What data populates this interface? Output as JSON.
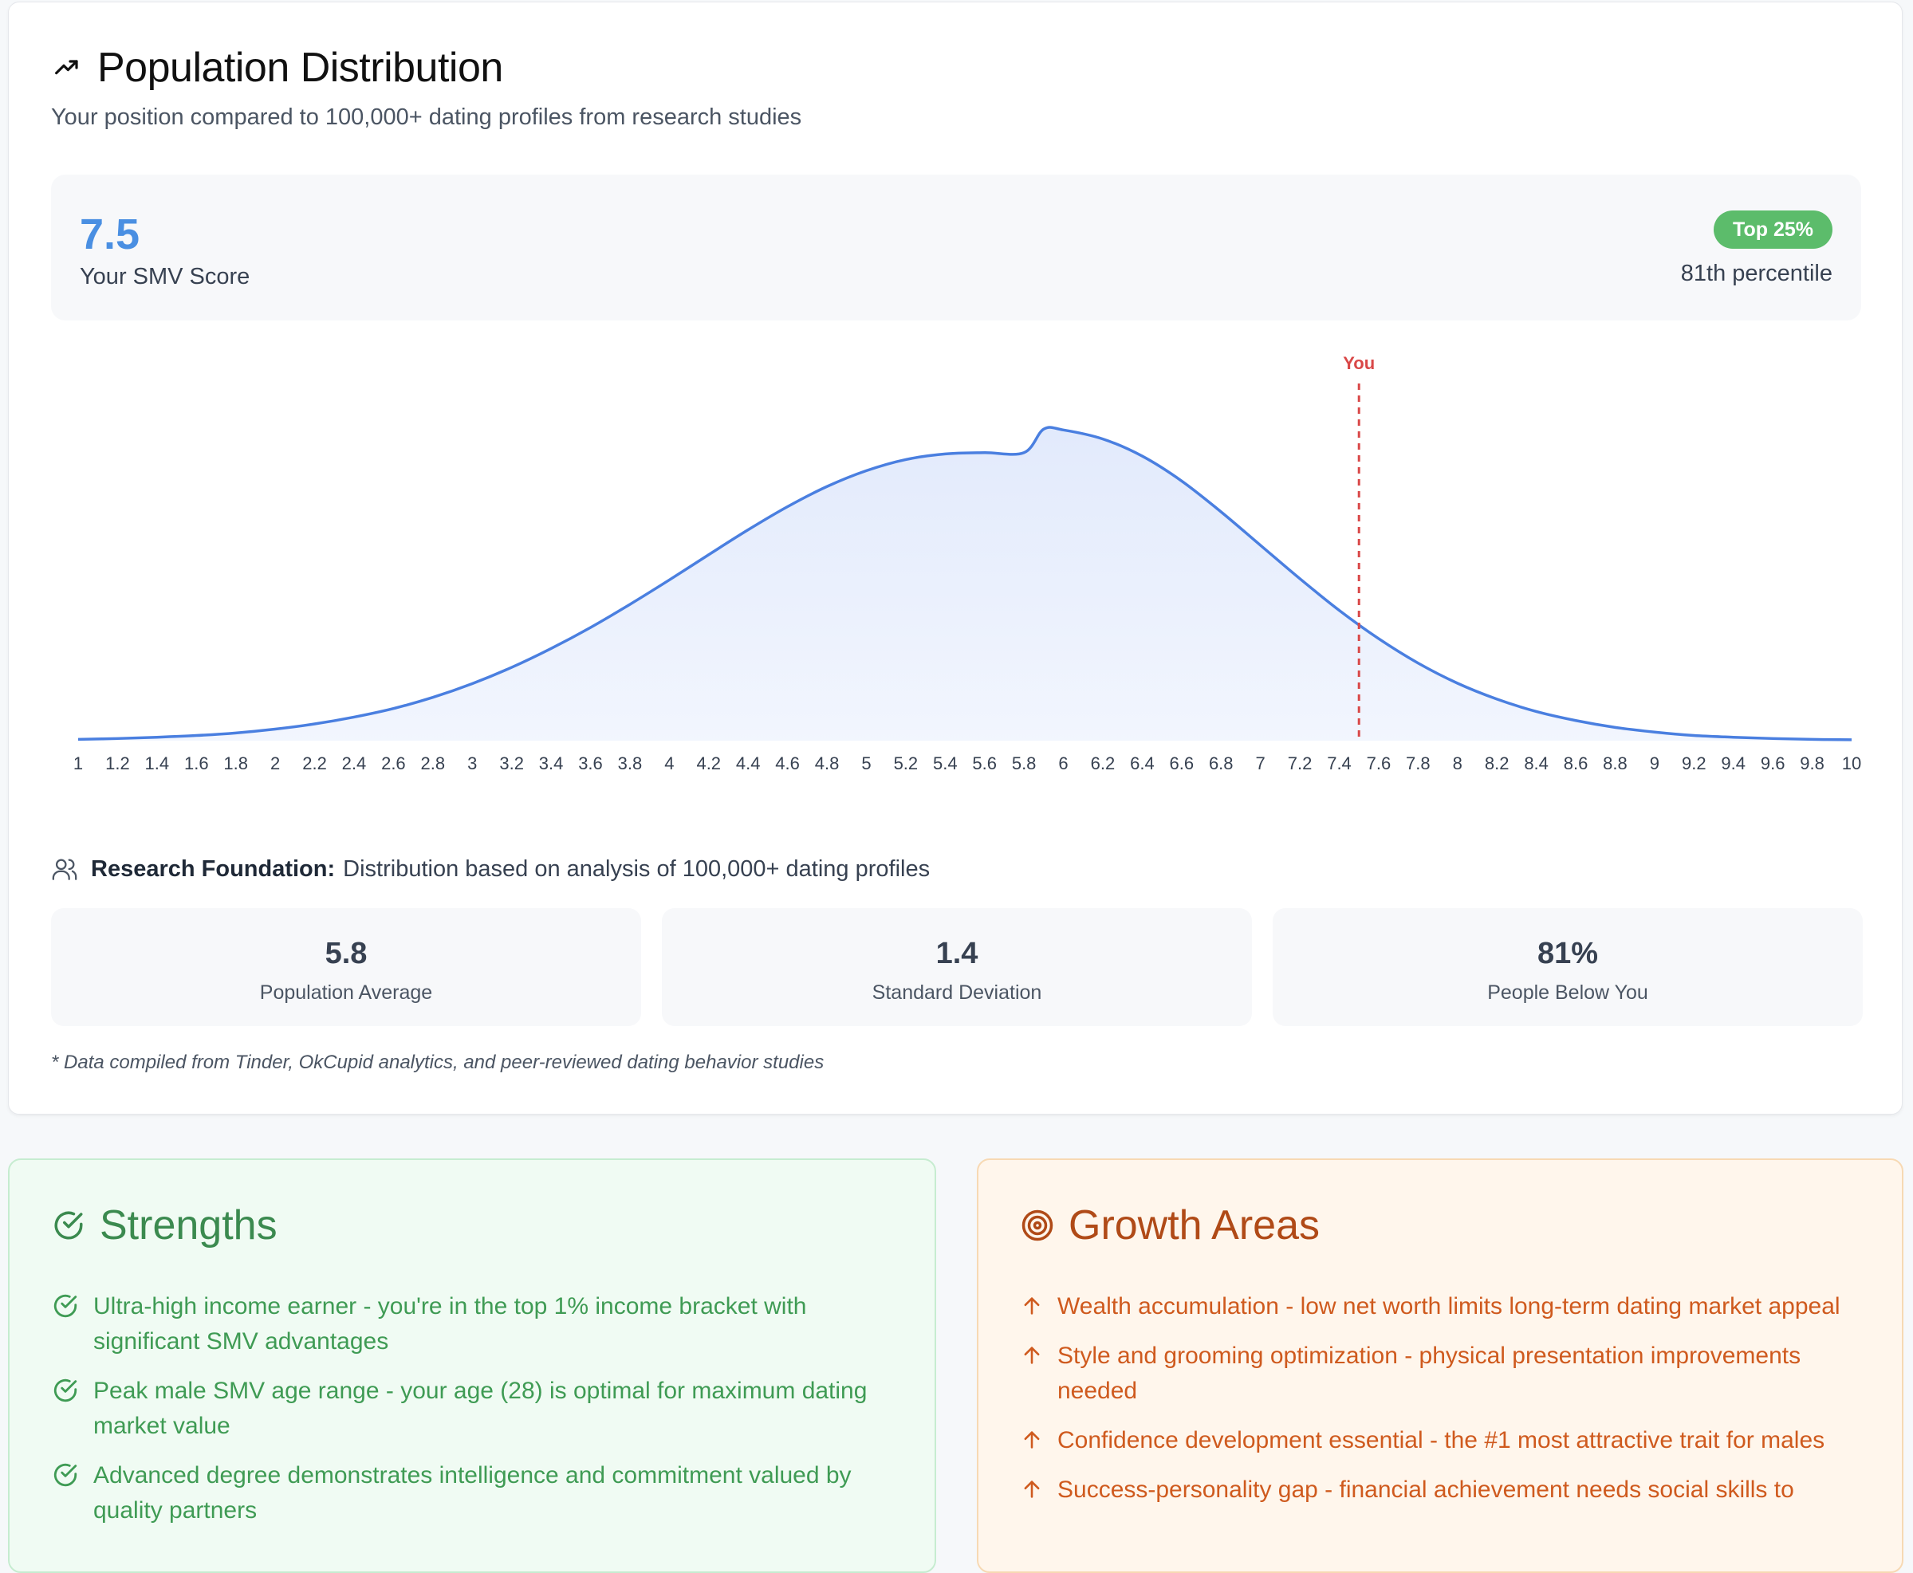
{
  "distribution": {
    "title": "Population Distribution",
    "subtitle": "Your position compared to 100,000+ dating profiles from research studies",
    "score": {
      "value": "7.5",
      "label": "Your SMV Score"
    },
    "badge": "Top 25%",
    "percentile": "81th percentile",
    "research": {
      "bold": "Research Foundation:",
      "text": "Distribution based on analysis of 100,000+ dating profiles"
    },
    "stats": [
      {
        "value": "5.8",
        "label": "Population Average"
      },
      {
        "value": "1.4",
        "label": "Standard Deviation"
      },
      {
        "value": "81%",
        "label": "People Below You"
      }
    ],
    "footnote": "* Data compiled from Tinder, OkCupid analytics, and peer-reviewed dating behavior studies"
  },
  "chart_data": {
    "type": "area",
    "title": "",
    "xlabel": "",
    "ylabel": "",
    "xlim": [
      1,
      10
    ],
    "x_ticks": [
      "1",
      "1.2",
      "1.4",
      "1.6",
      "1.8",
      "2",
      "2.2",
      "2.4",
      "2.6",
      "2.8",
      "3",
      "3.2",
      "3.4",
      "3.6",
      "3.8",
      "4",
      "4.2",
      "4.4",
      "4.6",
      "4.8",
      "5",
      "5.2",
      "5.4",
      "5.6",
      "5.8",
      "6",
      "6.2",
      "6.4",
      "6.6",
      "6.8",
      "7",
      "7.2",
      "7.4",
      "7.6",
      "7.8",
      "8",
      "8.2",
      "8.4",
      "8.6",
      "8.8",
      "9",
      "9.2",
      "9.4",
      "9.6",
      "9.8",
      "10"
    ],
    "series": [
      {
        "x": [
          1,
          1.2,
          1.4,
          1.6,
          1.8,
          2,
          2.2,
          2.4,
          2.6,
          2.8,
          3,
          3.2,
          3.4,
          3.6,
          3.8,
          4,
          4.2,
          4.4,
          4.6,
          4.8,
          5,
          5.2,
          5.4,
          5.6,
          5.8,
          5.9,
          6,
          6.2,
          6.4,
          6.6,
          6.8,
          7,
          7.2,
          7.4,
          7.6,
          7.8,
          8,
          8.2,
          8.4,
          8.6,
          8.8,
          9,
          9.2,
          9.4,
          9.6,
          9.8,
          10
        ],
        "values": [
          0.003,
          0.005,
          0.008,
          0.012,
          0.018,
          0.027,
          0.039,
          0.055,
          0.075,
          0.101,
          0.133,
          0.171,
          0.215,
          0.264,
          0.318,
          0.375,
          0.434,
          0.492,
          0.546,
          0.593,
          0.63,
          0.656,
          0.669,
          0.672,
          0.672,
          0.727,
          0.725,
          0.704,
          0.664,
          0.606,
          0.534,
          0.456,
          0.378,
          0.304,
          0.238,
          0.181,
          0.134,
          0.097,
          0.068,
          0.047,
          0.031,
          0.02,
          0.012,
          0.008,
          0.005,
          0.003,
          0.002
        ]
      }
    ],
    "marker": {
      "x": 7.5,
      "label": "You",
      "color": "#d94848"
    },
    "line_color": "#4a7fe0",
    "fill_color": "#e2eafc",
    "grid": false
  },
  "strengths": {
    "title": "Strengths",
    "items": [
      "Ultra-high income earner - you're in the top 1% income bracket with significant SMV advantages",
      "Peak male SMV age range - your age (28) is optimal for maximum dating market value",
      "Advanced degree demonstrates intelligence and commitment valued by quality partners"
    ]
  },
  "growth": {
    "title": "Growth Areas",
    "items": [
      "Wealth accumulation - low net worth limits long-term dating market appeal",
      "Style and grooming optimization - physical presentation improvements needed",
      "Confidence development essential - the #1 most attractive trait for males",
      "Success-personality gap - financial achievement needs social skills to"
    ]
  },
  "colors": {
    "accent_blue": "#4a8fe2",
    "badge_green": "#5cbc6b",
    "strength_green": "#3f9b54",
    "growth_orange": "#cf5a1e"
  }
}
